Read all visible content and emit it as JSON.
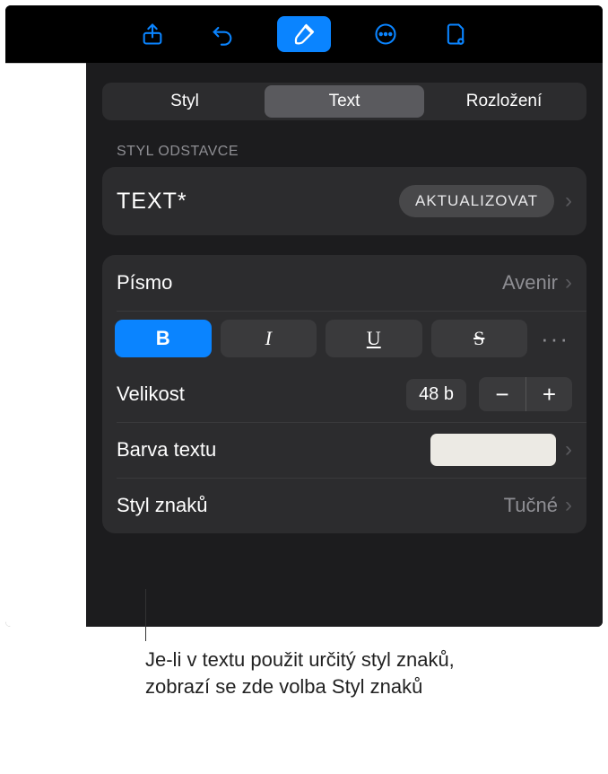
{
  "toolbar": {
    "icons": [
      "share",
      "undo",
      "format",
      "more",
      "document"
    ]
  },
  "tabs": {
    "style": "Styl",
    "text": "Text",
    "layout": "Rozložení",
    "active": "text"
  },
  "paragraph_style": {
    "section_label": "STYL ODSTAVCE",
    "name": "TEXT*",
    "update_label": "AKTUALIZOVAT"
  },
  "font": {
    "label": "Písmo",
    "value": "Avenir"
  },
  "format_buttons": {
    "bold": "B",
    "italic": "I",
    "underline": "U",
    "strike": "S",
    "more": "···",
    "active": "bold"
  },
  "size": {
    "label": "Velikost",
    "value": "48 b",
    "minus": "−",
    "plus": "+"
  },
  "text_color": {
    "label": "Barva textu",
    "swatch": "#eceae4"
  },
  "char_style": {
    "label": "Styl znaků",
    "value": "Tučné"
  },
  "callout": "Je-li v textu použit určitý styl znaků, zobrazí se zde volba Styl znaků"
}
